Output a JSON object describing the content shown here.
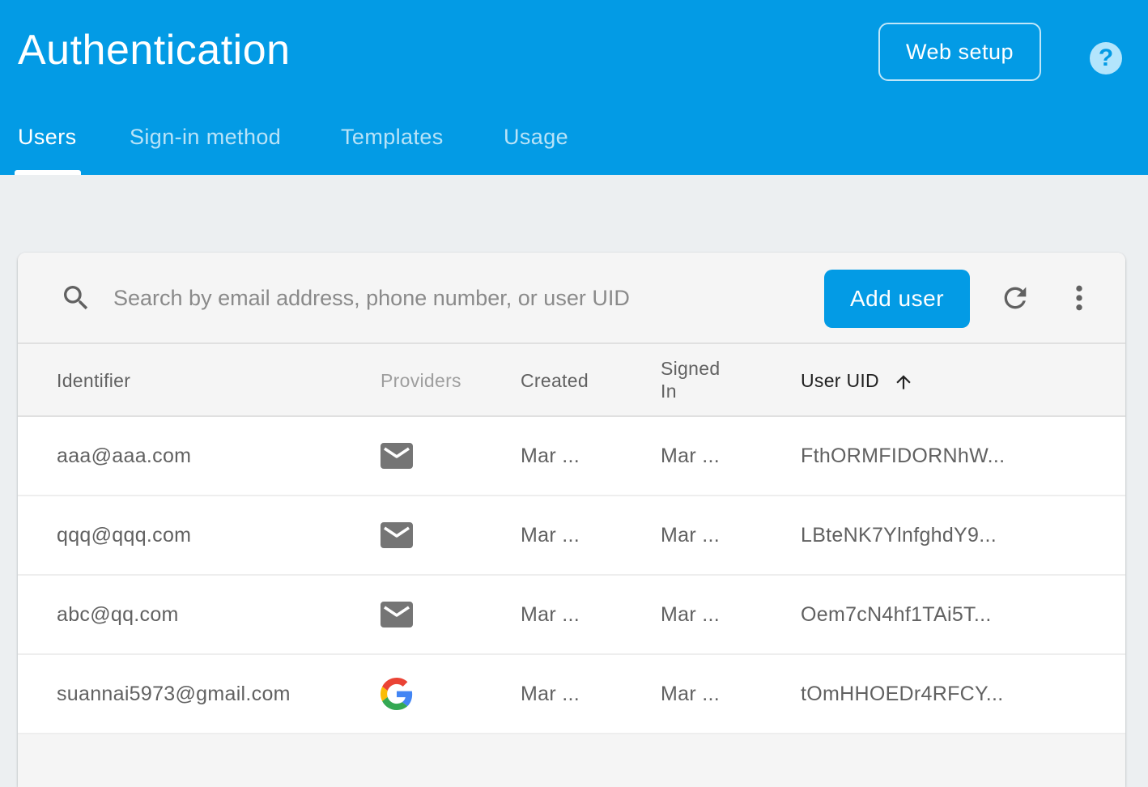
{
  "header": {
    "title": "Authentication",
    "web_setup_label": "Web setup",
    "help_label": "?",
    "tabs": [
      {
        "label": "Users",
        "active": true
      },
      {
        "label": "Sign-in method",
        "active": false
      },
      {
        "label": "Templates",
        "active": false
      },
      {
        "label": "Usage",
        "active": false
      }
    ]
  },
  "toolbar": {
    "search_placeholder": "Search by email address, phone number, or user UID",
    "search_icon": "search-icon",
    "add_user_label": "Add user",
    "refresh_icon": "refresh-icon",
    "more_icon": "more-vert-icon"
  },
  "table": {
    "columns": {
      "identifier": "Identifier",
      "providers": "Providers",
      "created": "Created",
      "signed_in_line1": "Signed",
      "signed_in_line2": "In",
      "user_uid": "User UID"
    },
    "sort": {
      "column": "User UID",
      "direction": "ascending"
    },
    "rows": [
      {
        "identifier": "aaa@aaa.com",
        "provider": "email",
        "created": "Mar ...",
        "signed_in": "Mar ...",
        "uid": "FthORMFIDORNhW..."
      },
      {
        "identifier": "qqq@qqq.com",
        "provider": "email",
        "created": "Mar ...",
        "signed_in": "Mar ...",
        "uid": "LBteNK7YlnfghdY9..."
      },
      {
        "identifier": "abc@qq.com",
        "provider": "email",
        "created": "Mar ...",
        "signed_in": "Mar ...",
        "uid": "Oem7cN4hf1TAi5T..."
      },
      {
        "identifier": "suannai5973@gmail.com",
        "provider": "google",
        "created": "Mar ...",
        "signed_in": "Mar ...",
        "uid": "tOmHHOEDr4RFCY..."
      }
    ]
  },
  "colors": {
    "brand": "#039be5",
    "background": "#eceff1",
    "email_icon": "#757575"
  }
}
